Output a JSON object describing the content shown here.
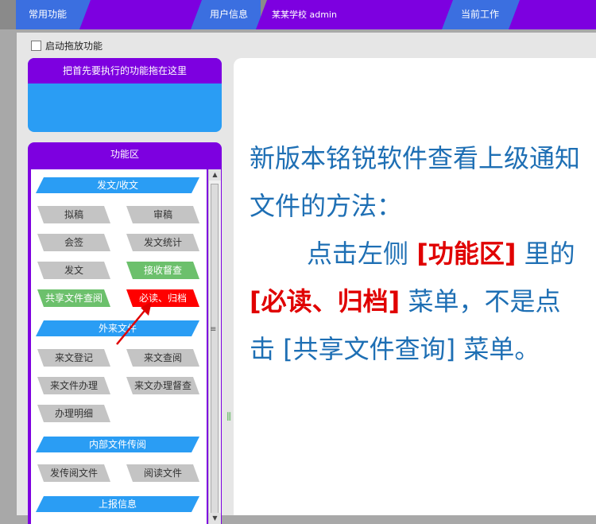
{
  "topbar": {
    "common_functions": "常用功能",
    "user_info": "用户信息",
    "school_user": "某某学校 admin",
    "current_work": "当前工作"
  },
  "drag": {
    "label": "启动拖放功能",
    "checked": false
  },
  "dropzone": {
    "title": "把首先要执行的功能拖在这里"
  },
  "funcarea": {
    "title": "功能区",
    "sections": [
      {
        "title": "发文/收文",
        "items": [
          "拟稿",
          "审稿",
          "会签",
          "发文统计",
          "发文",
          "接收督查",
          "共享文件查阅",
          "必读、归档"
        ]
      },
      {
        "title": "外来文件",
        "items": [
          "来文登记",
          "来文查阅",
          "来文件办理",
          "来文办理督查",
          "办理明细"
        ]
      },
      {
        "title": "内部文件传阅",
        "items": [
          "发传阅文件",
          "阅读文件"
        ]
      },
      {
        "title": "上报信息",
        "items": []
      }
    ]
  },
  "content": {
    "line1": "新版本铭锐软件查看上级通知文件的方法：",
    "p2_a": "点击左侧",
    "p2_hl1": "[功能区]",
    "p2_b": "里的",
    "p2_hl2": "[必读、归档]",
    "p2_c": "菜单，不是点击 [共享文件查询] 菜单。"
  },
  "colors": {
    "purple": "#7d00e0",
    "blue": "#2a9df4",
    "tab_blue": "#3b6fe0",
    "green_button": "#6cc06c",
    "red_button": "#ff0000",
    "content_text": "#1e6fb4",
    "highlight_text": "#e00000"
  }
}
